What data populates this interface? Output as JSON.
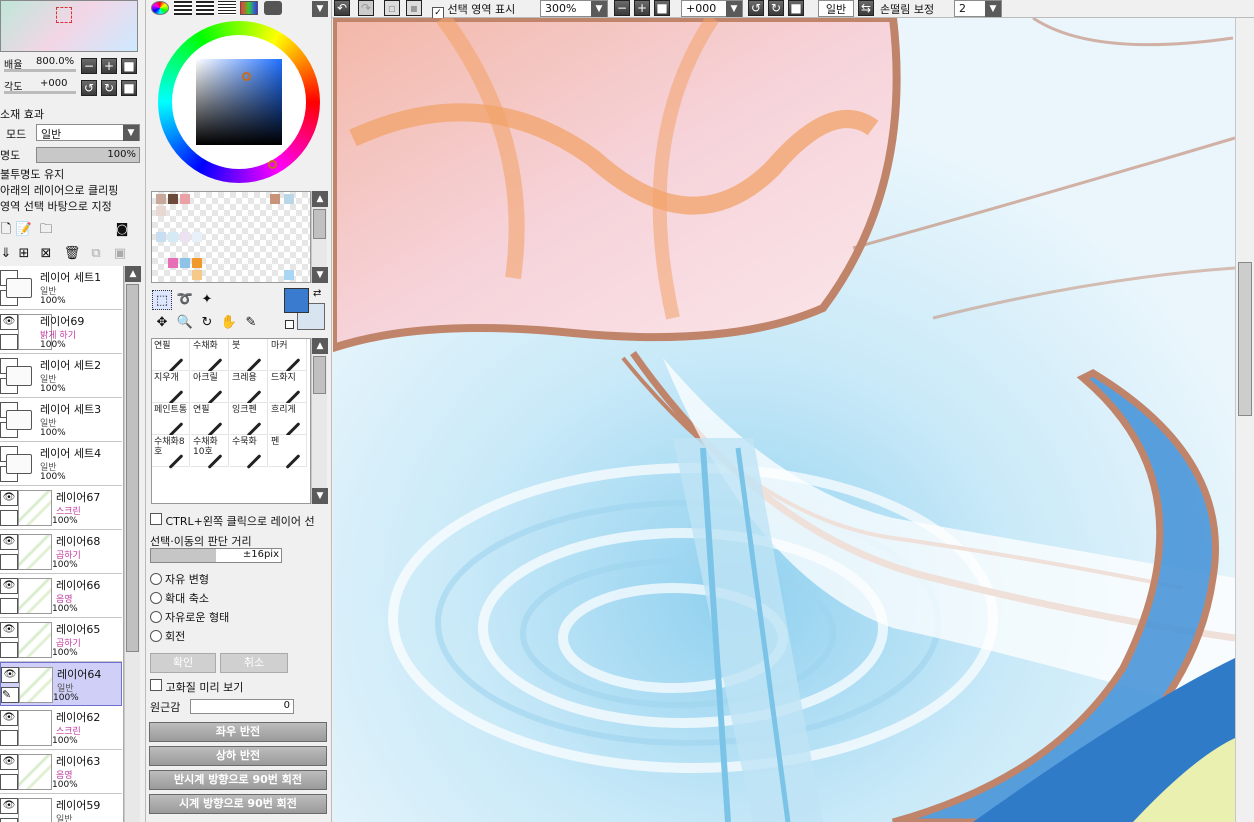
{
  "navigator": {
    "zoom_label": "배율",
    "zoom_value": "800.0%",
    "angle_label": "각도",
    "angle_value": "+000"
  },
  "layer_props": {
    "effect_label": "소재 효과",
    "mode_label": "모드",
    "mode_value": "일반",
    "opacity_label": "명도",
    "opacity_value": "100%",
    "preserve_opacity": "불투명도 유지",
    "clip_lower": "아래의 레이어으로 클리핑",
    "selection_source": "영역 선택 바탕으로 지정"
  },
  "layers": [
    {
      "name": "레이어 세트1",
      "mode": "일반",
      "opacity": "100%",
      "type": "folder",
      "mode_color": "normal"
    },
    {
      "name": "레이어69",
      "mode": "밝게 하기",
      "opacity": "100%",
      "type": "layer",
      "mode_color": "pink"
    },
    {
      "name": "레이어 세트2",
      "mode": "일반",
      "opacity": "100%",
      "type": "folder",
      "mode_color": "normal"
    },
    {
      "name": "레이어 세트3",
      "mode": "일반",
      "opacity": "100%",
      "type": "folder",
      "mode_color": "normal"
    },
    {
      "name": "레이어 세트4",
      "mode": "일반",
      "opacity": "100%",
      "type": "folder-open",
      "mode_color": "normal"
    },
    {
      "name": "레이어67",
      "mode": "스크린",
      "opacity": "100%",
      "type": "layer",
      "mode_color": "pink"
    },
    {
      "name": "레이어68",
      "mode": "곱하기",
      "opacity": "100%",
      "type": "layer",
      "mode_color": "pink"
    },
    {
      "name": "레이어66",
      "mode": "음영",
      "opacity": "100%",
      "type": "layer",
      "mode_color": "pink"
    },
    {
      "name": "레이어65",
      "mode": "곱하기",
      "opacity": "100%",
      "type": "layer",
      "mode_color": "pink"
    },
    {
      "name": "레이어64",
      "mode": "일반",
      "opacity": "100%",
      "type": "layer",
      "mode_color": "normal",
      "selected": true
    },
    {
      "name": "레이어62",
      "mode": "스크린",
      "opacity": "100%",
      "type": "layer",
      "mode_color": "pink"
    },
    {
      "name": "레이어63",
      "mode": "음영",
      "opacity": "100%",
      "type": "layer",
      "mode_color": "pink"
    },
    {
      "name": "레이어59",
      "mode": "일반",
      "opacity": "",
      "type": "layer",
      "mode_color": "normal"
    }
  ],
  "brushes": [
    {
      "name": "연필",
      "icon": "pencil-icon"
    },
    {
      "name": "수채화",
      "icon": "watercolor-icon"
    },
    {
      "name": "붓",
      "icon": "brush-icon"
    },
    {
      "name": "마커",
      "icon": "marker-icon"
    },
    {
      "name": "지우개",
      "icon": "eraser-icon"
    },
    {
      "name": "아크릴",
      "icon": "acrylic-icon"
    },
    {
      "name": "크레용",
      "icon": "crayon-icon"
    },
    {
      "name": "드화지",
      "icon": "paper-icon"
    },
    {
      "name": "페인트통",
      "icon": "bucket-icon"
    },
    {
      "name": "연필",
      "icon": "pencil-icon"
    },
    {
      "name": "잉크펜",
      "icon": "inkpen-icon"
    },
    {
      "name": "흐리게",
      "icon": "blur-icon"
    },
    {
      "name": "수채화8호",
      "icon": "watercolor-icon"
    },
    {
      "name": "수채화10호",
      "icon": "watercolor-icon"
    },
    {
      "name": "수묵화",
      "icon": "ink-icon"
    },
    {
      "name": "펜",
      "icon": "pen-icon"
    }
  ],
  "transform": {
    "ctrl_click": "CTRL+왼쪽 클릭으로 레이어 선",
    "distance_label": "선택·이동의 판단 거리",
    "distance_value": "±16pix",
    "options": [
      "자유 변형",
      "확대 축소",
      "자유로운 형태",
      "회전"
    ],
    "ok": "확인",
    "cancel": "취소",
    "hq_preview": "고화질 미리 보기",
    "perspective_label": "원근감",
    "perspective_value": "0",
    "flip_h": "좌우 반전",
    "flip_v": "상하 반전",
    "rot_ccw": "반시계 방향으로 90번 회전",
    "rot_cw": "시계 방향으로 90번 회전"
  },
  "toolbar": {
    "show_selection": "선택 영역 표시",
    "zoom": "300%",
    "angle": "+000",
    "mode": "일반",
    "stabilizer_label": "손떨림 보정",
    "stabilizer_value": "2"
  },
  "colors": {
    "primary": "#3a7bd0",
    "secondary": "#d8e4f0",
    "accent": "#3060c0"
  }
}
